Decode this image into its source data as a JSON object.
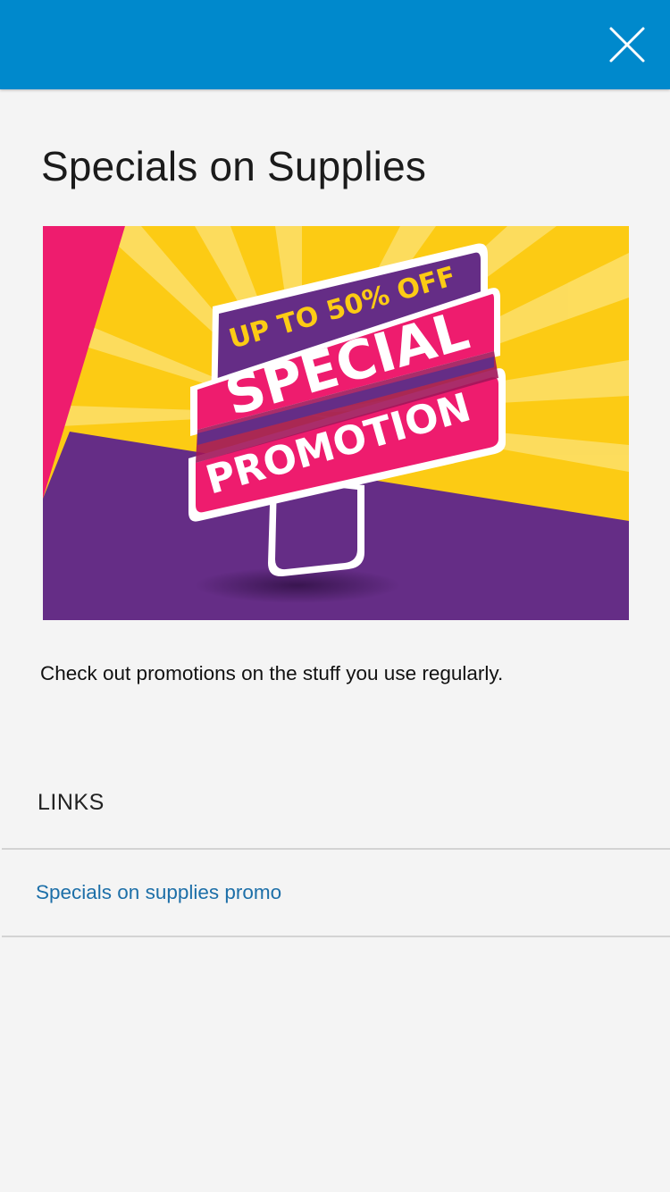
{
  "header": {
    "close_icon": "close-icon",
    "color": "#0089cc"
  },
  "page": {
    "title": "Specials on Supplies",
    "description": "Check out promotions on the stuff you use regularly."
  },
  "banner": {
    "line1": "UP TO 50% OFF",
    "line2": "SPECIAL",
    "line3": "PROMOTION",
    "colors": {
      "yellow": "#fccb14",
      "magenta": "#ee1c6e",
      "purple": "#652d86"
    }
  },
  "links": {
    "heading": "LINKS",
    "items": [
      {
        "label": "Specials on supplies promo"
      }
    ],
    "link_color": "#1d6fa8"
  }
}
